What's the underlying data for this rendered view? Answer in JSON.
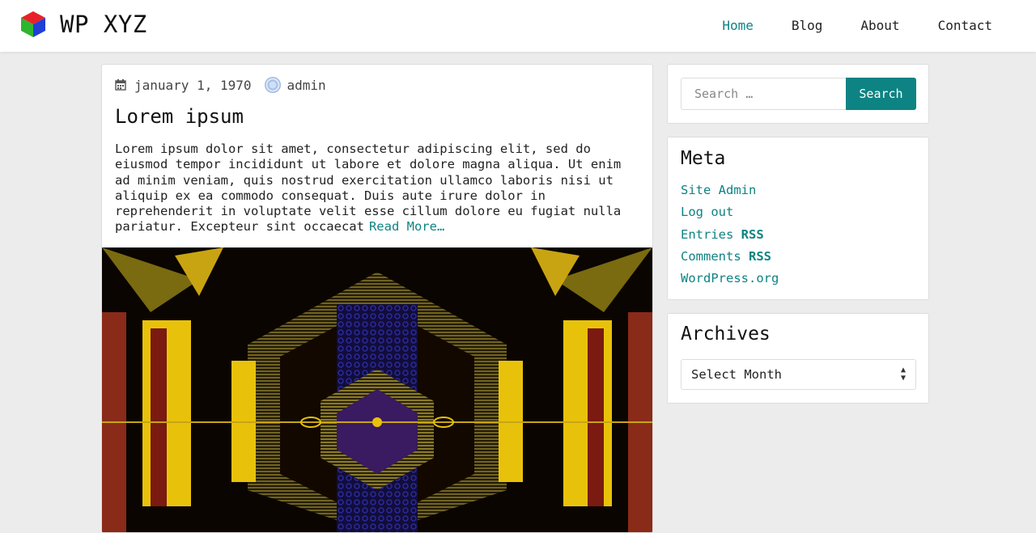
{
  "site": {
    "title": "WP XYZ",
    "logo_icon": "rgb-cube-icon"
  },
  "nav": {
    "items": [
      {
        "label": "Home",
        "active": true
      },
      {
        "label": "Blog",
        "active": false
      },
      {
        "label": "About",
        "active": false
      },
      {
        "label": "Contact",
        "active": false
      }
    ]
  },
  "post": {
    "date": "january 1, 1970",
    "author": "admin",
    "title": "Lorem ipsum",
    "excerpt": "Lorem ipsum dolor sit amet, consectetur adipiscing elit, sed do eiusmod tempor incididunt ut labore et dolore magna aliqua. Ut enim ad minim veniam, quis nostrud exercitation ullamco laboris nisi ut aliquip ex ea commodo consequat. Duis aute irure dolor in reprehenderit in voluptate velit esse cillum dolore eu fugiat nulla pariatur. Excepteur sint occaecat",
    "read_more": "Read More…",
    "image_icon": "kaleidoscope-image"
  },
  "sidebar": {
    "search": {
      "placeholder": "Search …",
      "button_label": "Search"
    },
    "meta": {
      "title": "Meta",
      "links": [
        {
          "text": "Site Admin",
          "abbr": ""
        },
        {
          "text": "Log out",
          "abbr": ""
        },
        {
          "text": "Entries ",
          "abbr": "RSS"
        },
        {
          "text": "Comments ",
          "abbr": "RSS"
        },
        {
          "text": "WordPress.org",
          "abbr": ""
        }
      ]
    },
    "archives": {
      "title": "Archives",
      "selected": "Select Month"
    }
  },
  "colors": {
    "accent": "#0e8383",
    "background": "#ececec"
  }
}
